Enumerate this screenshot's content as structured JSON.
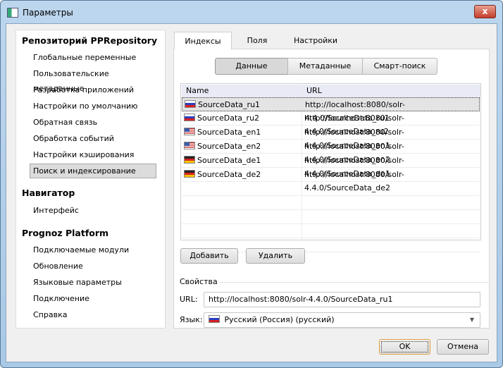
{
  "window": {
    "title": "Параметры",
    "close": "x"
  },
  "sidebar": {
    "groups": [
      {
        "title": "Репозиторий PPRepository",
        "items": [
          "Глобальные переменные",
          "Пользовательские метаданные",
          "Разработка приложений",
          "Настройки по умолчанию",
          "Обратная связь",
          "Обработка событий",
          "Настройки кэширования",
          "Поиск и индексирование"
        ]
      },
      {
        "title": "Навигатор",
        "items": [
          "Интерфейс"
        ]
      },
      {
        "title": "Prognoz Platform",
        "items": [
          "Подключаемые модули",
          "Обновление",
          "Языковые параметры",
          "Подключение",
          "Справка"
        ]
      }
    ],
    "selected": "Поиск и индексирование"
  },
  "tabs": [
    "Индексы",
    "Поля",
    "Настройки"
  ],
  "segments": [
    "Данные",
    "Метаданные",
    "Смарт-поиск"
  ],
  "table": {
    "columns": [
      "Name",
      "URL"
    ],
    "rows": [
      {
        "flag": "ru",
        "name": "SourceData_ru1",
        "url": "http://localhost:8080/solr-4.4.0/SourceData_ru1"
      },
      {
        "flag": "ru",
        "name": "SourceData_ru2",
        "url": "http://localhost:8080/solr-4.4.0/SourceData_ru2"
      },
      {
        "flag": "en",
        "name": "SourceData_en1",
        "url": "http://localhost:8080/solr-4.4.0/SourceData_en1"
      },
      {
        "flag": "en",
        "name": "SourceData_en2",
        "url": "http://localhost:8080/solr-4.4.0/SourceData_en2"
      },
      {
        "flag": "de",
        "name": "SourceData_de1",
        "url": "http://localhost:8080/solr-4.4.0/SourceData_de1"
      },
      {
        "flag": "de",
        "name": "SourceData_de2",
        "url": "http://localhost:8080/solr-4.4.0/SourceData_de2"
      }
    ]
  },
  "buttons": {
    "add": "Добавить",
    "delete": "Удалить",
    "ok": "OK",
    "cancel": "Отмена"
  },
  "properties": {
    "title": "Свойства",
    "url_label": "URL:",
    "url_value": "http://localhost:8080/solr-4.4.0/SourceData_ru1",
    "lang_label": "Язык:",
    "lang_value": "Русский (Россия) (русский)"
  }
}
